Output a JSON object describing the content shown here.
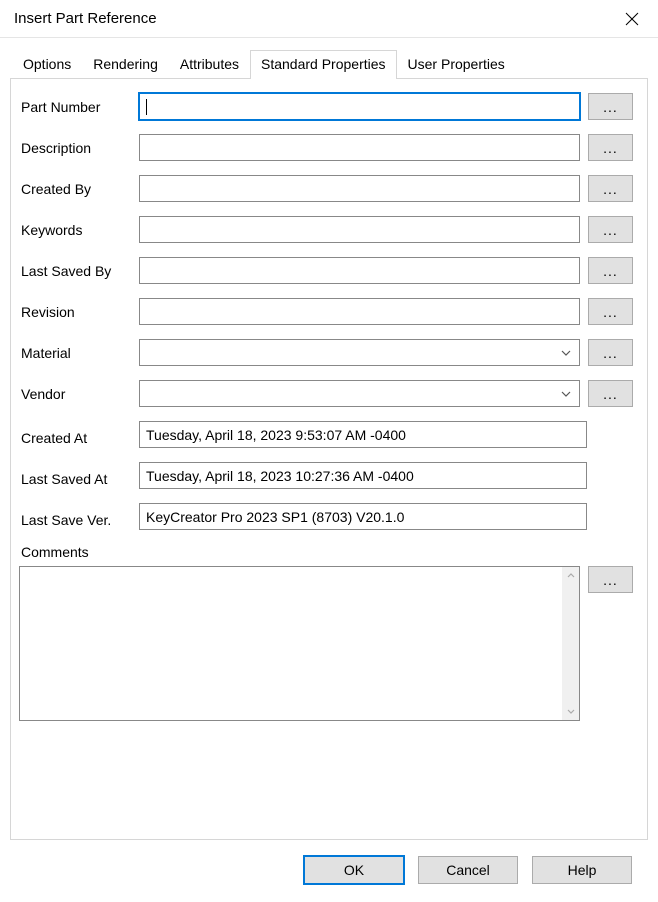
{
  "window": {
    "title": "Insert Part Reference"
  },
  "tabs": {
    "options": "Options",
    "rendering": "Rendering",
    "attributes": "Attributes",
    "standardProperties": "Standard Properties",
    "userProperties": "User Properties"
  },
  "labels": {
    "partNumber": "Part Number",
    "description": "Description",
    "createdBy": "Created By",
    "keywords": "Keywords",
    "lastSavedBy": "Last Saved By",
    "revision": "Revision",
    "material": "Material",
    "vendor": "Vendor",
    "createdAt": "Created At",
    "lastSavedAt": "Last Saved At",
    "lastSaveVer": "Last Save Ver.",
    "comments": "Comments"
  },
  "values": {
    "partNumber": "",
    "description": "",
    "createdBy": "",
    "keywords": "",
    "lastSavedBy": "",
    "revision": "",
    "material": "",
    "vendor": "",
    "createdAt": "Tuesday, April 18, 2023 9:53:07 AM -0400",
    "lastSavedAt": "Tuesday, April 18, 2023 10:27:36 AM -0400",
    "lastSaveVer": "KeyCreator Pro 2023 SP1 (8703) V20.1.0",
    "comments": ""
  },
  "buttons": {
    "browse": "...",
    "ok": "OK",
    "cancel": "Cancel",
    "help": "Help"
  }
}
